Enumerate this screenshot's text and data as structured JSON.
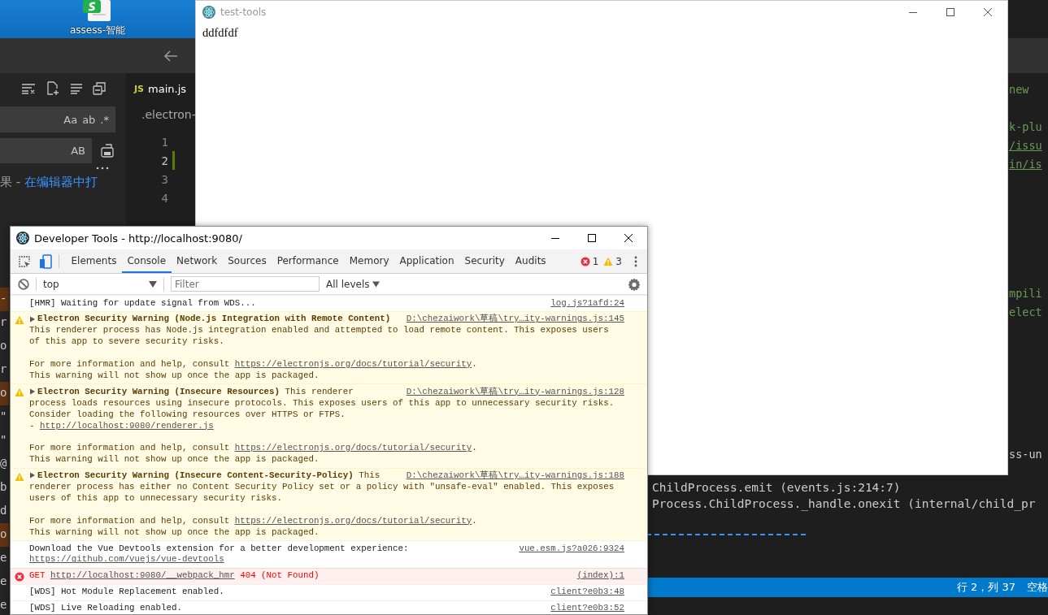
{
  "desktop": {
    "icon_label": "assess-智能"
  },
  "editor": {
    "search": {
      "toggles": [
        "Aa",
        "ab",
        ".*"
      ]
    },
    "replace": {
      "toggles": [
        "AB"
      ]
    },
    "result_hint": {
      "text": "果 - ",
      "link": "在编辑器中打"
    },
    "left_fragments": [
      {
        "text": "-",
        "highlighted": true
      },
      {
        "text": "r",
        "highlighted": false
      },
      {
        "text": "o",
        "highlighted": false
      },
      {
        "text": "r",
        "highlighted": false
      },
      {
        "text": "o",
        "highlighted": true
      },
      {
        "text": "\"",
        "highlighted": false
      },
      {
        "text": "\"",
        "highlighted": false
      },
      {
        "text": "@",
        "highlighted": false
      },
      {
        "text": "b",
        "highlighted": false
      },
      {
        "text": "d",
        "highlighted": false
      },
      {
        "text": "o",
        "highlighted": true
      },
      {
        "text": "e",
        "highlighted": false
      },
      {
        "text": "e",
        "highlighted": false
      },
      {
        "text": "e",
        "highlighted": false
      }
    ],
    "tab": {
      "badge": "JS",
      "label": "main.js"
    },
    "breadcrumb": ".electron-",
    "lines": [
      {
        "number": "1",
        "modified": false
      },
      {
        "number": "2",
        "modified": true
      },
      {
        "number": "3",
        "modified": false
      },
      {
        "number": "4",
        "modified": false
      }
    ],
    "output_fragments": [
      {
        "text": "new",
        "kind": "comment"
      },
      {
        "text": "k-plu",
        "kind": "comment"
      },
      {
        "text": "/issu",
        "kind": "link"
      },
      {
        "text": "in/is",
        "kind": "link"
      },
      {
        "text": "mpili",
        "kind": "comment"
      },
      {
        "text": "elect",
        "kind": "comment"
      },
      {
        "text": "ss-un",
        "kind": "plain"
      }
    ],
    "terminal_lines": [
      "ChildProcess.emit (events.js:214:7)",
      "Process.ChildProcess._handle.onexit (internal/child_pr"
    ],
    "status_bar": {
      "position": "行 2，列 37",
      "indent": "空格"
    }
  },
  "app_window": {
    "title": "test-tools",
    "content": "ddfdfdf"
  },
  "devtools": {
    "title": "Developer Tools - http://localhost:9080/",
    "tabs": [
      {
        "label": "Elements",
        "selected": false
      },
      {
        "label": "Console",
        "selected": true
      },
      {
        "label": "Network",
        "selected": false
      },
      {
        "label": "Sources",
        "selected": false
      },
      {
        "label": "Performance",
        "selected": false
      },
      {
        "label": "Memory",
        "selected": false
      },
      {
        "label": "Application",
        "selected": false
      },
      {
        "label": "Security",
        "selected": false
      },
      {
        "label": "Audits",
        "selected": false
      }
    ],
    "errors": "1",
    "warnings": "3",
    "context": "top",
    "filter_placeholder": "Filter",
    "levels": "All levels",
    "messages": [
      {
        "kind": "log",
        "source": "log.js?1afd:24",
        "paragraphs": [
          [
            {
              "text": "[HMR] Waiting for update signal from WDS..."
            }
          ]
        ]
      },
      {
        "kind": "warning",
        "head": "Electron Security Warning (Node.js Integration with Remote Content)",
        "source": "D:\\chezaiwork\\草稿\\try…ity-warnings.js:145",
        "paragraphs": [
          [
            {
              "text": "This renderer process has Node.js integration enabled and attempted to load remote content. This exposes users"
            },
            {
              "text": "of this app to severe security risks."
            }
          ],
          [
            {
              "text": "For more information and help, consult ",
              "link": "https://electronjs.org/docs/tutorial/security",
              "after": "."
            },
            {
              "text": "This warning will not show up once the app is packaged."
            }
          ]
        ]
      },
      {
        "kind": "warning",
        "head": "Electron Security Warning (Insecure Resources)",
        "head_rest": " This renderer",
        "source": "D:\\chezaiwork\\草稿\\try…ity-warnings.js:128",
        "paragraphs": [
          [
            {
              "text": "process loads resources using insecure protocols. This exposes users of this app to unnecessary security risks."
            },
            {
              "text": "Consider loading the following resources over HTTPS or FTPS."
            },
            {
              "text": "- ",
              "link": "http://localhost:9080/renderer.js"
            }
          ],
          [
            {
              "text": "For more information and help, consult ",
              "link": "https://electronjs.org/docs/tutorial/security",
              "after": "."
            },
            {
              "text": "This warning will not show up once the app is packaged."
            }
          ]
        ]
      },
      {
        "kind": "warning",
        "head": "Electron Security Warning (Insecure Content-Security-Policy)",
        "head_rest": " This",
        "source": "D:\\chezaiwork\\草稿\\try…ity-warnings.js:188",
        "paragraphs": [
          [
            {
              "text": "renderer process has either no Content Security Policy set or a policy with \"unsafe-eval\" enabled. This exposes"
            },
            {
              "text": "users of this app to unnecessary security risks."
            }
          ],
          [
            {
              "text": "For more information and help, consult ",
              "link": "https://electronjs.org/docs/tutorial/security",
              "after": "."
            },
            {
              "text": "This warning will not show up once the app is packaged."
            }
          ]
        ]
      },
      {
        "kind": "log",
        "source": "vue.esm.js?a026:9324",
        "paragraphs": [
          [
            {
              "text": "Download the Vue Devtools extension for a better development experience:"
            },
            {
              "link": "https://github.com/vuejs/vue-devtools"
            }
          ]
        ]
      },
      {
        "kind": "error",
        "source": "(index):1",
        "paragraphs": [
          [
            {
              "text": "GET ",
              "link": "http://localhost:9080/__webpack_hmr",
              "after": " 404 (Not Found)"
            }
          ]
        ]
      },
      {
        "kind": "log",
        "source": "client?e0b3:48",
        "paragraphs": [
          [
            {
              "text": "[WDS] Hot Module Replacement enabled."
            }
          ]
        ]
      },
      {
        "kind": "log",
        "source": "client?e0b3:52",
        "paragraphs": [
          [
            {
              "text": "[WDS] Live Reloading enabled."
            }
          ]
        ]
      }
    ]
  }
}
